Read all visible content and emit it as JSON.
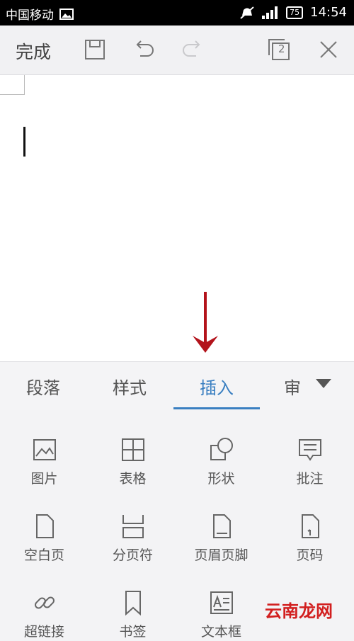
{
  "status": {
    "carrier": "中国移动",
    "battery": "75",
    "time": "14:54"
  },
  "toolbar": {
    "done_label": "完成",
    "page_count": "2"
  },
  "tabs": [
    {
      "label": "段落"
    },
    {
      "label": "样式"
    },
    {
      "label": "插入"
    },
    {
      "label": "审"
    }
  ],
  "insert_items": [
    {
      "label": "图片",
      "icon": "image-icon"
    },
    {
      "label": "表格",
      "icon": "table-icon"
    },
    {
      "label": "形状",
      "icon": "shape-icon"
    },
    {
      "label": "批注",
      "icon": "comment-icon"
    },
    {
      "label": "空白页",
      "icon": "blank-page-icon"
    },
    {
      "label": "分页符",
      "icon": "page-break-icon"
    },
    {
      "label": "页眉页脚",
      "icon": "header-footer-icon"
    },
    {
      "label": "页码",
      "icon": "page-number-icon"
    },
    {
      "label": "超链接",
      "icon": "link-icon"
    },
    {
      "label": "书签",
      "icon": "bookmark-icon"
    },
    {
      "label": "文本框",
      "icon": "text-box-icon"
    }
  ],
  "watermark": "云南龙网"
}
